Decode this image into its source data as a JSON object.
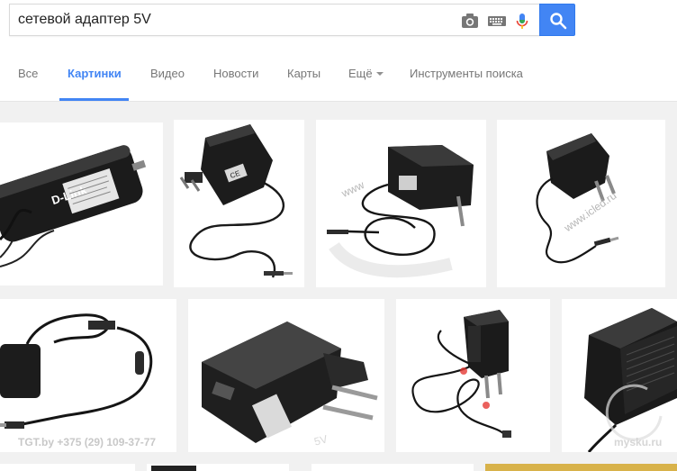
{
  "search": {
    "query": "сетевой адаптер 5V",
    "icons": [
      "camera-icon",
      "keyboard-icon",
      "microphone-icon",
      "search-icon"
    ]
  },
  "tabs": [
    {
      "label": "Все",
      "active": false
    },
    {
      "label": "Картинки",
      "active": true
    },
    {
      "label": "Видео",
      "active": false
    },
    {
      "label": "Новости",
      "active": false
    },
    {
      "label": "Карты",
      "active": false
    },
    {
      "label": "Ещё",
      "active": false
    },
    {
      "label": "Инструменты поиска",
      "active": false
    }
  ],
  "results": {
    "row1": [
      {
        "brand_text": "D-Link"
      },
      {
        "label_text": "CE"
      },
      {
        "watermark": "www"
      },
      {
        "watermark": "www.icled.ru"
      }
    ],
    "row2": [
      {
        "watermark": "TGT.by  +375 (29) 109-37-77"
      },
      {
        "watermark": "5V"
      },
      {
        "watermark": ""
      },
      {
        "watermark": "mysku.ru"
      }
    ]
  },
  "colors": {
    "accent": "#4285f4",
    "tab_text": "#777777",
    "background": "#f1f1f1"
  }
}
